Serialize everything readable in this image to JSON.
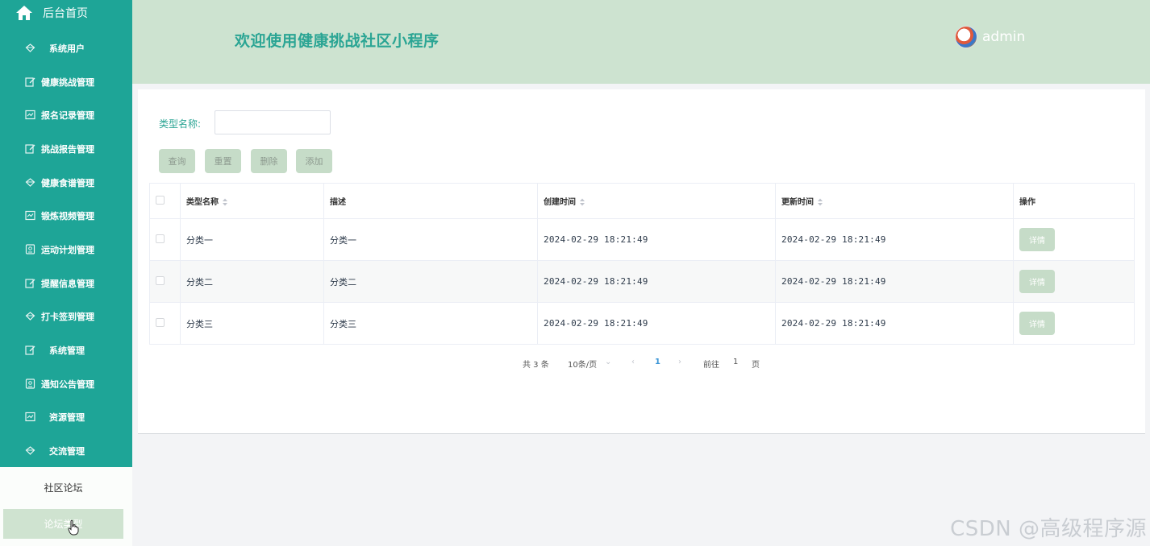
{
  "sidebar": {
    "home_label": "后台首页",
    "items": [
      {
        "label": "系统用户",
        "icon": "diamond-icon"
      },
      {
        "label": "健康挑战管理",
        "icon": "edit-icon"
      },
      {
        "label": "报名记录管理",
        "icon": "chart-icon"
      },
      {
        "label": "挑战报告管理",
        "icon": "edit-icon"
      },
      {
        "label": "健康食谱管理",
        "icon": "diamond-icon"
      },
      {
        "label": "锻炼视频管理",
        "icon": "chart-icon"
      },
      {
        "label": "运动计划管理",
        "icon": "badge-icon"
      },
      {
        "label": "提醒信息管理",
        "icon": "edit-icon"
      },
      {
        "label": "打卡签到管理",
        "icon": "diamond-icon"
      },
      {
        "label": "系统管理",
        "icon": "edit-icon"
      },
      {
        "label": "通知公告管理",
        "icon": "badge-icon"
      },
      {
        "label": "资源管理",
        "icon": "chart-icon"
      },
      {
        "label": "交流管理",
        "icon": "diamond-icon"
      }
    ],
    "sub_items": [
      {
        "label": "社区论坛",
        "active": false
      },
      {
        "label": "论坛类型",
        "active": true
      }
    ]
  },
  "header": {
    "title": "欢迎使用健康挑战社区小程序",
    "username": "admin"
  },
  "filter": {
    "label": "类型名称:",
    "value": "",
    "placeholder": ""
  },
  "buttons": {
    "query": "查询",
    "reset": "重置",
    "delete": "删除",
    "add": "添加"
  },
  "table": {
    "columns": [
      "类型名称",
      "描述",
      "创建时间",
      "更新时间",
      "操作"
    ],
    "rows": [
      {
        "name": "分类一",
        "desc": "分类一",
        "created": "2024-02-29 18:21:49",
        "updated": "2024-02-29 18:21:49",
        "action": "详情"
      },
      {
        "name": "分类二",
        "desc": "分类二",
        "created": "2024-02-29 18:21:49",
        "updated": "2024-02-29 18:21:49",
        "action": "详情"
      },
      {
        "name": "分类三",
        "desc": "分类三",
        "created": "2024-02-29 18:21:49",
        "updated": "2024-02-29 18:21:49",
        "action": "详情"
      }
    ]
  },
  "pagination": {
    "total": "共 3 条",
    "page_size": "10条/页",
    "current_page": "1",
    "goto_prefix": "前往",
    "goto_value": "1",
    "goto_suffix": "页"
  },
  "watermark": "CSDN @高级程序源",
  "colors": {
    "sidebar": "#1ea597",
    "header": "#cde3d0",
    "accent": "#2ba594",
    "button": "#c6dcc8"
  }
}
